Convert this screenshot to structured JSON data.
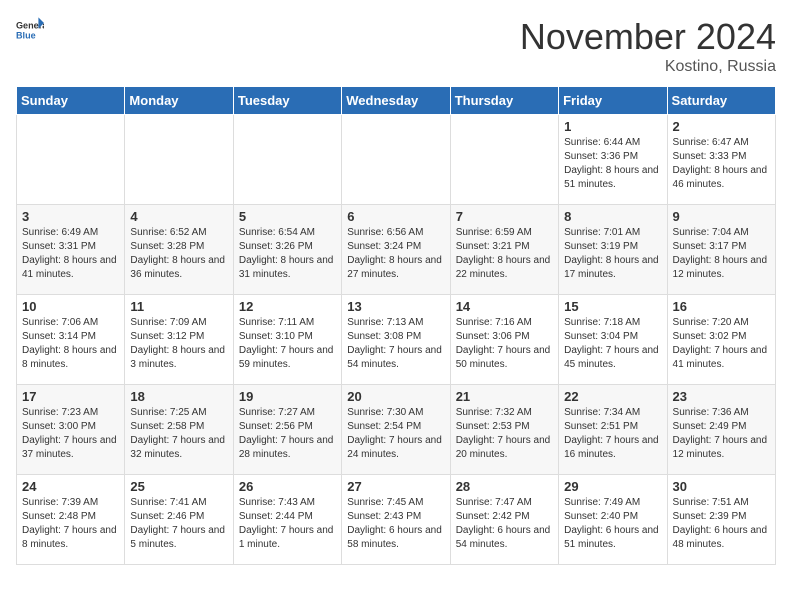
{
  "logo": {
    "text_general": "General",
    "text_blue": "Blue"
  },
  "title": "November 2024",
  "location": "Kostino, Russia",
  "weekdays": [
    "Sunday",
    "Monday",
    "Tuesday",
    "Wednesday",
    "Thursday",
    "Friday",
    "Saturday"
  ],
  "weeks": [
    [
      {
        "day": "",
        "info": ""
      },
      {
        "day": "",
        "info": ""
      },
      {
        "day": "",
        "info": ""
      },
      {
        "day": "",
        "info": ""
      },
      {
        "day": "",
        "info": ""
      },
      {
        "day": "1",
        "info": "Sunrise: 6:44 AM\nSunset: 3:36 PM\nDaylight: 8 hours and 51 minutes."
      },
      {
        "day": "2",
        "info": "Sunrise: 6:47 AM\nSunset: 3:33 PM\nDaylight: 8 hours and 46 minutes."
      }
    ],
    [
      {
        "day": "3",
        "info": "Sunrise: 6:49 AM\nSunset: 3:31 PM\nDaylight: 8 hours and 41 minutes."
      },
      {
        "day": "4",
        "info": "Sunrise: 6:52 AM\nSunset: 3:28 PM\nDaylight: 8 hours and 36 minutes."
      },
      {
        "day": "5",
        "info": "Sunrise: 6:54 AM\nSunset: 3:26 PM\nDaylight: 8 hours and 31 minutes."
      },
      {
        "day": "6",
        "info": "Sunrise: 6:56 AM\nSunset: 3:24 PM\nDaylight: 8 hours and 27 minutes."
      },
      {
        "day": "7",
        "info": "Sunrise: 6:59 AM\nSunset: 3:21 PM\nDaylight: 8 hours and 22 minutes."
      },
      {
        "day": "8",
        "info": "Sunrise: 7:01 AM\nSunset: 3:19 PM\nDaylight: 8 hours and 17 minutes."
      },
      {
        "day": "9",
        "info": "Sunrise: 7:04 AM\nSunset: 3:17 PM\nDaylight: 8 hours and 12 minutes."
      }
    ],
    [
      {
        "day": "10",
        "info": "Sunrise: 7:06 AM\nSunset: 3:14 PM\nDaylight: 8 hours and 8 minutes."
      },
      {
        "day": "11",
        "info": "Sunrise: 7:09 AM\nSunset: 3:12 PM\nDaylight: 8 hours and 3 minutes."
      },
      {
        "day": "12",
        "info": "Sunrise: 7:11 AM\nSunset: 3:10 PM\nDaylight: 7 hours and 59 minutes."
      },
      {
        "day": "13",
        "info": "Sunrise: 7:13 AM\nSunset: 3:08 PM\nDaylight: 7 hours and 54 minutes."
      },
      {
        "day": "14",
        "info": "Sunrise: 7:16 AM\nSunset: 3:06 PM\nDaylight: 7 hours and 50 minutes."
      },
      {
        "day": "15",
        "info": "Sunrise: 7:18 AM\nSunset: 3:04 PM\nDaylight: 7 hours and 45 minutes."
      },
      {
        "day": "16",
        "info": "Sunrise: 7:20 AM\nSunset: 3:02 PM\nDaylight: 7 hours and 41 minutes."
      }
    ],
    [
      {
        "day": "17",
        "info": "Sunrise: 7:23 AM\nSunset: 3:00 PM\nDaylight: 7 hours and 37 minutes."
      },
      {
        "day": "18",
        "info": "Sunrise: 7:25 AM\nSunset: 2:58 PM\nDaylight: 7 hours and 32 minutes."
      },
      {
        "day": "19",
        "info": "Sunrise: 7:27 AM\nSunset: 2:56 PM\nDaylight: 7 hours and 28 minutes."
      },
      {
        "day": "20",
        "info": "Sunrise: 7:30 AM\nSunset: 2:54 PM\nDaylight: 7 hours and 24 minutes."
      },
      {
        "day": "21",
        "info": "Sunrise: 7:32 AM\nSunset: 2:53 PM\nDaylight: 7 hours and 20 minutes."
      },
      {
        "day": "22",
        "info": "Sunrise: 7:34 AM\nSunset: 2:51 PM\nDaylight: 7 hours and 16 minutes."
      },
      {
        "day": "23",
        "info": "Sunrise: 7:36 AM\nSunset: 2:49 PM\nDaylight: 7 hours and 12 minutes."
      }
    ],
    [
      {
        "day": "24",
        "info": "Sunrise: 7:39 AM\nSunset: 2:48 PM\nDaylight: 7 hours and 8 minutes."
      },
      {
        "day": "25",
        "info": "Sunrise: 7:41 AM\nSunset: 2:46 PM\nDaylight: 7 hours and 5 minutes."
      },
      {
        "day": "26",
        "info": "Sunrise: 7:43 AM\nSunset: 2:44 PM\nDaylight: 7 hours and 1 minute."
      },
      {
        "day": "27",
        "info": "Sunrise: 7:45 AM\nSunset: 2:43 PM\nDaylight: 6 hours and 58 minutes."
      },
      {
        "day": "28",
        "info": "Sunrise: 7:47 AM\nSunset: 2:42 PM\nDaylight: 6 hours and 54 minutes."
      },
      {
        "day": "29",
        "info": "Sunrise: 7:49 AM\nSunset: 2:40 PM\nDaylight: 6 hours and 51 minutes."
      },
      {
        "day": "30",
        "info": "Sunrise: 7:51 AM\nSunset: 2:39 PM\nDaylight: 6 hours and 48 minutes."
      }
    ]
  ]
}
